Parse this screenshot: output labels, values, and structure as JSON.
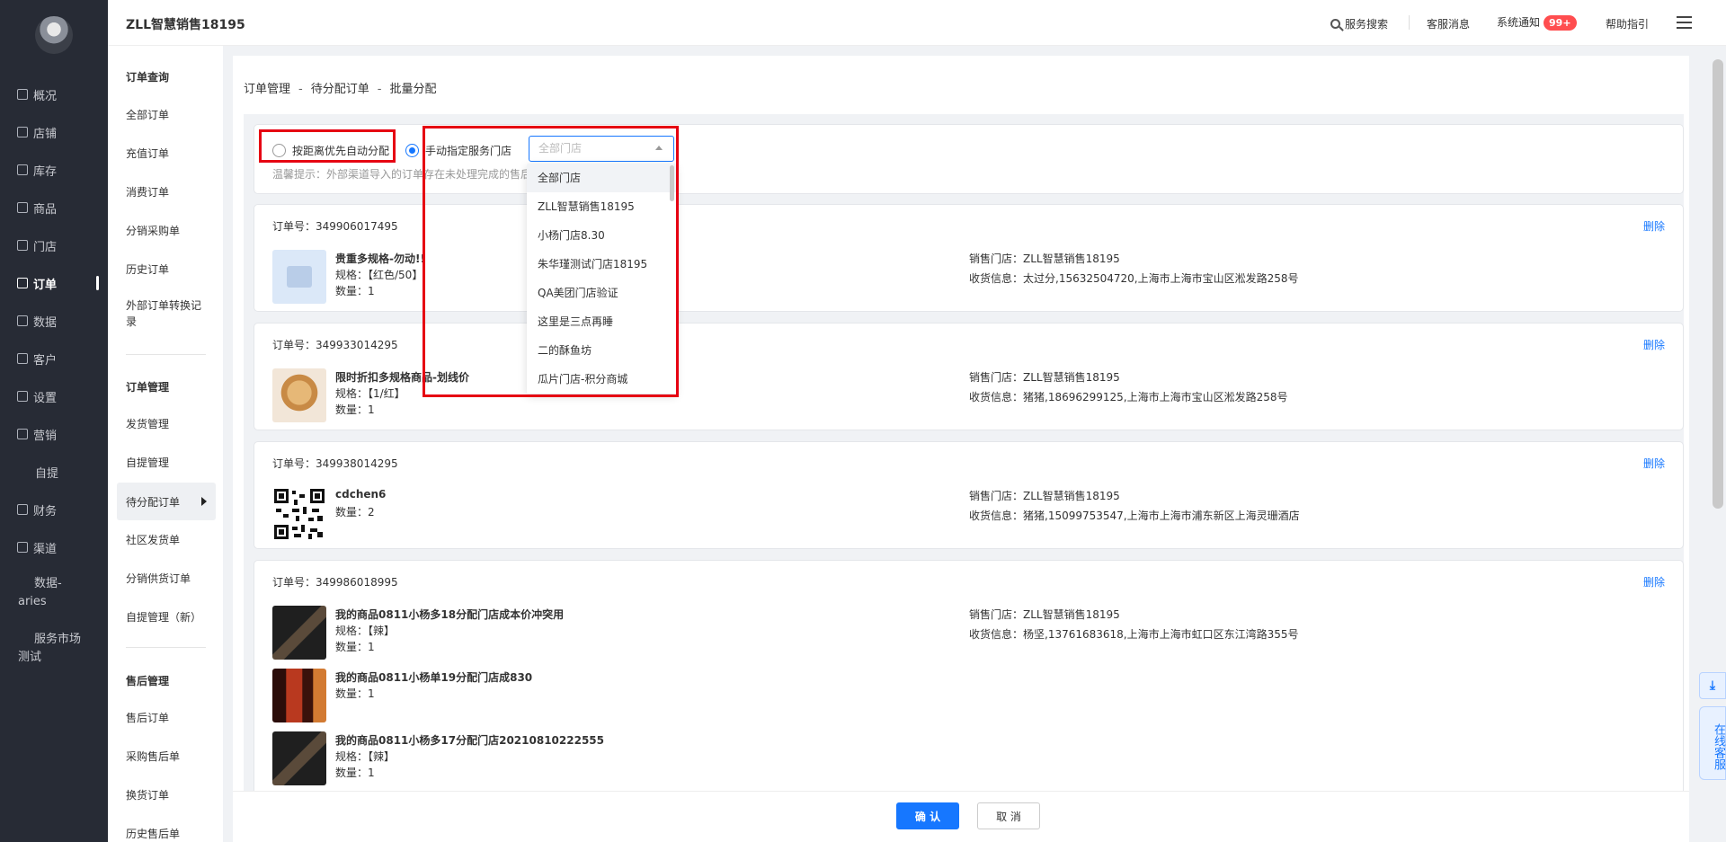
{
  "header": {
    "brand": "ZLL智慧销售18195",
    "search": "服务搜索",
    "service_msg": "客服消息",
    "sys_notice": "系统通知",
    "notice_badge": "99+",
    "help": "帮助指引"
  },
  "sidebar": {
    "items": [
      {
        "label": "概况",
        "icon": "overview-icon"
      },
      {
        "label": "店铺",
        "icon": "shop-icon"
      },
      {
        "label": "库存",
        "icon": "stock-icon"
      },
      {
        "label": "商品",
        "icon": "goods-icon"
      },
      {
        "label": "门店",
        "icon": "store-icon"
      },
      {
        "label": "订单",
        "icon": "order-icon"
      },
      {
        "label": "数据",
        "icon": "data-icon"
      },
      {
        "label": "客户",
        "icon": "customer-icon"
      },
      {
        "label": "设置",
        "icon": "settings-icon"
      },
      {
        "label": "营销",
        "icon": "marketing-icon"
      },
      {
        "label": "自提",
        "icon": ""
      },
      {
        "label": "财务",
        "icon": "finance-icon"
      },
      {
        "label": "渠道",
        "icon": "channel-icon"
      },
      {
        "label_line1": "数据-",
        "label_line2": "aries"
      },
      {
        "label_line1": "服务市场",
        "label_line2": "测试"
      }
    ]
  },
  "submenu": {
    "sec1_title": "订单查询",
    "sec1": [
      "全部订单",
      "充值订单",
      "消费订单",
      "分销采购单",
      "历史订单",
      "外部订单转换记",
      "录"
    ],
    "sec2_title": "订单管理",
    "sec2": [
      "发货管理",
      "自提管理",
      "待分配订单",
      "社区发货单",
      "分销供货订单",
      "自提管理（新）"
    ],
    "sec3_title": "售后管理",
    "sec3": [
      "售后订单",
      "采购售后单",
      "换货订单",
      "历史售后单"
    ]
  },
  "breadcrumb": [
    "订单管理",
    "待分配订单",
    "批量分配"
  ],
  "options": {
    "auto": "按距离优先自动分配",
    "manual": "手动指定服务门店",
    "select_placeholder": "全部门店",
    "tip": "温馨提示：外部渠道导入的订单存在未处理完成的售后"
  },
  "dropdown": [
    "全部门店",
    "ZLL智慧销售18195",
    "小杨门店8.30",
    "朱华瑾测试门店18195",
    "QA美团门店验证",
    "这里是三点再睡",
    "二的酥鱼坊",
    "瓜片门店-积分商城"
  ],
  "orders": [
    {
      "no_label": "订单号：349906017495",
      "delete": "删除",
      "goods": [
        {
          "name": "贵重多规格-勿动!!",
          "spec": "规格：【红色/50】",
          "qty": "数量：1"
        }
      ],
      "sale_store": "销售门店：ZLL智慧销售18195",
      "receiver": "收货信息：太过分,15632504720,上海市上海市宝山区淞发路258号"
    },
    {
      "no_label": "订单号：349933014295",
      "delete": "删除",
      "goods": [
        {
          "name": "限时折扣多规格商品-划线价",
          "spec": "规格：【1/红】",
          "qty": "数量：1"
        }
      ],
      "sale_store": "销售门店：ZLL智慧销售18195",
      "receiver": "收货信息：猪猪,18696299125,上海市上海市宝山区淞发路258号"
    },
    {
      "no_label": "订单号：349938014295",
      "delete": "删除",
      "goods": [
        {
          "name": "cdchen6",
          "spec": "",
          "qty": "数量：2"
        }
      ],
      "sale_store": "销售门店：ZLL智慧销售18195",
      "receiver": "收货信息：猪猪,15099753547,上海市上海市浦东新区上海灵珊酒店"
    },
    {
      "no_label": "订单号：349986018995",
      "delete": "删除",
      "goods": [
        {
          "name": "我的商品0811小杨多18分配门店成本价冲突用",
          "spec": "规格：【辣】",
          "qty": "数量：1"
        },
        {
          "name": "我的商品0811小杨单19分配门店成830",
          "spec": "",
          "qty": "数量：1"
        },
        {
          "name": "我的商品0811小杨多17分配门店20210810222555",
          "spec": "规格：【辣】",
          "qty": "数量：1"
        }
      ],
      "sale_store": "销售门店：ZLL智慧销售18195",
      "receiver": "收货信息：杨坚,13761683618,上海市上海市虹口区东江湾路355号"
    }
  ],
  "footer": {
    "confirm": "确 认",
    "cancel": "取 消"
  },
  "float": {
    "download": "⤓",
    "service": "在线客服"
  },
  "colors": {
    "primary": "#1677ff",
    "sidebar": "#272b35",
    "highlight": "#e60012",
    "badge": "#ff4d4f"
  }
}
